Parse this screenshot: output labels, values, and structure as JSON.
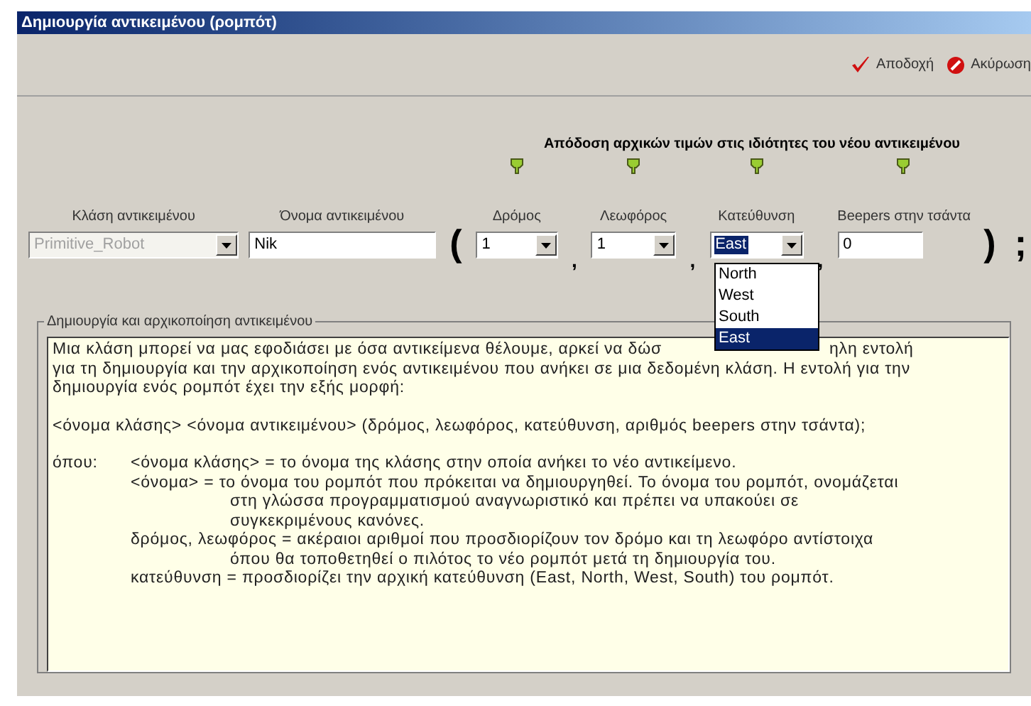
{
  "window": {
    "title": "Δημιουργία αντικειμένου (ρομπότ)"
  },
  "toolbar": {
    "buttons": [
      {
        "label": "Αποδοχή",
        "kind": "accept"
      },
      {
        "label": "Ακύρωση",
        "kind": "cancel"
      }
    ]
  },
  "header": "Απόδοση αρχικών τιμών στις ιδιότητες του νέου αντικειμένου",
  "fields": [
    {
      "kind": "combo",
      "label": "Κλάση αντικειμένου",
      "value": "Primitive_Robot",
      "disabled": true,
      "pinned": false,
      "focused": false
    },
    {
      "kind": "input",
      "label": "Όνομα αντικειμένου",
      "value": "Nik",
      "pinned": false
    },
    {
      "kind": "punct",
      "text": "("
    },
    {
      "kind": "combo",
      "label": "Δρόμος",
      "value": "1",
      "disabled": false,
      "pinned": true,
      "focused": false
    },
    {
      "kind": "punct",
      "text": ","
    },
    {
      "kind": "combo",
      "label": "Λεωφόρος",
      "value": "1",
      "disabled": false,
      "pinned": true,
      "focused": false
    },
    {
      "kind": "punct",
      "text": ","
    },
    {
      "kind": "combo",
      "label": "Κατεύθυνση",
      "value": "East",
      "disabled": false,
      "pinned": true,
      "focused": true
    },
    {
      "kind": "punct",
      "text": ","
    },
    {
      "kind": "input",
      "label": "Beepers στην τσάντα",
      "value": "0",
      "pinned": true
    },
    {
      "kind": "punct",
      "text": ")"
    },
    {
      "kind": "punct",
      "text": ";"
    }
  ],
  "dropdown": {
    "options": [
      {
        "label": "North",
        "selected": false
      },
      {
        "label": "West",
        "selected": false
      },
      {
        "label": "South",
        "selected": false
      },
      {
        "label": "East",
        "selected": true
      }
    ]
  },
  "description": {
    "title": "Δημιουργία και αρχικοποίηση αντικειμένου",
    "first_line": [
      "Μια κλάση μπορεί να μας εφοδιάσει με όσα αντικείμενα θέλουμε, αρκεί να δώσ",
      "ηλη εντολή"
    ],
    "intro_lines": [
      "για τη δημιουργία και την αρχικοποίηση ενός αντικειμένου που ανήκει σε μια δεδομένη κλάση.  Η εντολή για την",
      "δημιουργία ενός ρομπότ έχει την εξής μορφή:"
    ],
    "syntax": "<όνομα κλάσης> <όνομα αντικειμένου> (δρόμος, λεωφόρος, κατεύθυνση, αριθμός beepers στην τσάντα);",
    "where_label": "όπου:",
    "definitions": [
      {
        "text": "<όνομα κλάσης> = το όνομα της κλάσης στην οποία ανήκει το νέο αντικείμενο."
      },
      {
        "text": "<όνομα> = το όνομα του ρομπότ που πρόκειται να δημιουργηθεί.  Το όνομα του ρομπότ, ονομάζεται",
        "continuation": [
          "στη γλώσσα προγραμματισμού αναγνωριστικό και πρέπει να υπακούει σε",
          "συγκεκριμένους κανόνες."
        ]
      },
      {
        "text": "δρόμος, λεωφόρος = ακέραιοι αριθμοί που προσδιορίζουν τον δρόμο και τη λεωφόρο αντίστοιχα",
        "continuation": [
          "όπου θα τοποθετηθεί ο πιλότος το νέο ρομπότ μετά τη δημιουργία του."
        ]
      },
      {
        "text": "κατεύθυνση = προσδιορίζει την αρχική κατεύθυνση (East, North, West, South) του ρομπότ."
      }
    ]
  }
}
